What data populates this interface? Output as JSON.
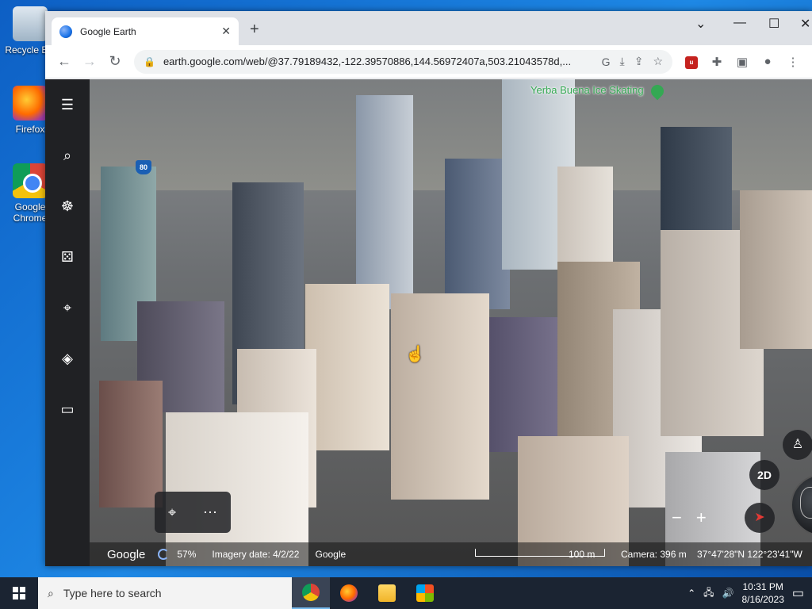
{
  "desktop": {
    "icons": [
      {
        "label": "Recycle Bin",
        "icon": "recycle-bin-icon"
      },
      {
        "label": "Firefox",
        "icon": "firefox-icon"
      },
      {
        "label": "Google Chrome",
        "icon": "chrome-icon"
      }
    ]
  },
  "browser": {
    "tab_title": "Google Earth",
    "url": "earth.google.com/web/@37.79189432,-122.39570886,144.56972407a,503.21043578d,..."
  },
  "earth": {
    "poi_label": "Yerba Buena Ice Skating",
    "highway_shield": "80",
    "mode_button": "2D",
    "status": {
      "logo": "Google",
      "progress": "57%",
      "imagery_date": "Imagery date: 4/2/22",
      "attribution": "Google",
      "scale": "100 m",
      "camera": "Camera: 396 m",
      "coordinates": "37°47'28\"N 122°23'41\"W"
    }
  },
  "taskbar": {
    "search_placeholder": "Type here to search",
    "time": "10:31 PM",
    "date": "8/16/2023"
  }
}
